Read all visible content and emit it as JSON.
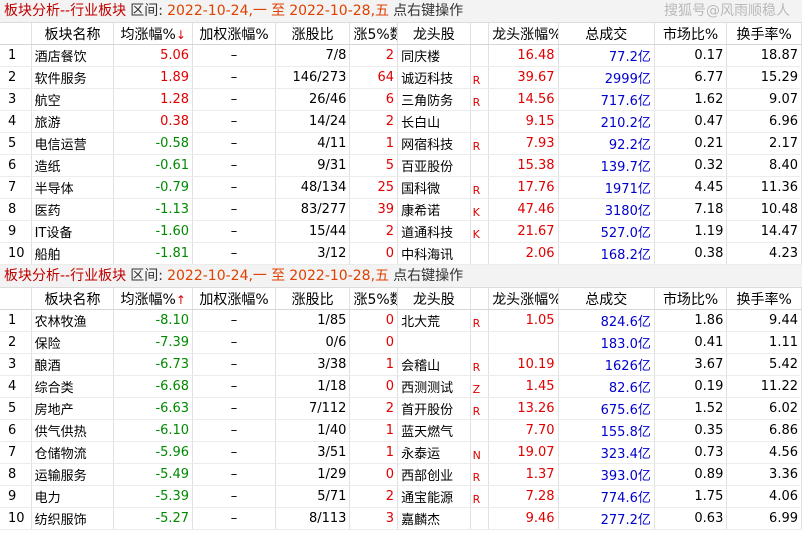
{
  "panels": [
    {
      "title": "板块分析--行业板块",
      "range_label": "区间:",
      "range_start": "2022-10-24,一",
      "range_to": "至",
      "range_end": "2022-10-28,五",
      "hint": "点右键操作",
      "watermark": "搜狐号@风雨顺稳人",
      "sort_arrow": "↓",
      "headers": [
        "",
        "板块名称",
        "均涨幅%",
        "加权涨幅%",
        "涨股比",
        "涨5%数",
        "龙头股",
        "",
        "龙头涨幅%",
        "总成交",
        "市场比%",
        "换手率%"
      ],
      "rows": [
        {
          "idx": "1",
          "name": "酒店餐饮",
          "avg": "5.06",
          "weighted": "–",
          "up_ratio": "7/8",
          "up5": "2",
          "leader": "同庆楼",
          "mark": "",
          "leader_chg": "16.48",
          "turnover": "77.2亿",
          "market": "0.17",
          "turnover_rate": "18.87"
        },
        {
          "idx": "2",
          "name": "软件服务",
          "avg": "1.89",
          "weighted": "–",
          "up_ratio": "146/273",
          "up5": "64",
          "leader": "诚迈科技",
          "mark": "R",
          "leader_chg": "39.67",
          "turnover": "2999亿",
          "market": "6.77",
          "turnover_rate": "15.29"
        },
        {
          "idx": "3",
          "name": "航空",
          "avg": "1.28",
          "weighted": "–",
          "up_ratio": "26/46",
          "up5": "6",
          "leader": "三角防务",
          "mark": "R",
          "leader_chg": "14.56",
          "turnover": "717.6亿",
          "market": "1.62",
          "turnover_rate": "9.07"
        },
        {
          "idx": "4",
          "name": "旅游",
          "avg": "0.38",
          "weighted": "–",
          "up_ratio": "14/24",
          "up5": "2",
          "leader": "长白山",
          "mark": "",
          "leader_chg": "9.15",
          "turnover": "210.2亿",
          "market": "0.47",
          "turnover_rate": "6.96"
        },
        {
          "idx": "5",
          "name": "电信运营",
          "avg": "-0.58",
          "weighted": "–",
          "up_ratio": "4/11",
          "up5": "1",
          "leader": "网宿科技",
          "mark": "R",
          "leader_chg": "7.93",
          "turnover": "92.2亿",
          "market": "0.21",
          "turnover_rate": "2.17"
        },
        {
          "idx": "6",
          "name": "造纸",
          "avg": "-0.61",
          "weighted": "–",
          "up_ratio": "9/31",
          "up5": "5",
          "leader": "百亚股份",
          "mark": "",
          "leader_chg": "15.38",
          "turnover": "139.7亿",
          "market": "0.32",
          "turnover_rate": "8.40"
        },
        {
          "idx": "7",
          "name": "半导体",
          "avg": "-0.79",
          "weighted": "–",
          "up_ratio": "48/134",
          "up5": "25",
          "leader": "国科微",
          "mark": "R",
          "leader_chg": "17.76",
          "turnover": "1971亿",
          "market": "4.45",
          "turnover_rate": "11.36"
        },
        {
          "idx": "8",
          "name": "医药",
          "avg": "-1.13",
          "weighted": "–",
          "up_ratio": "83/277",
          "up5": "39",
          "leader": "康希诺",
          "mark": "K",
          "leader_chg": "47.46",
          "turnover": "3180亿",
          "market": "7.18",
          "turnover_rate": "10.48"
        },
        {
          "idx": "9",
          "name": "IT设备",
          "avg": "-1.60",
          "weighted": "–",
          "up_ratio": "15/44",
          "up5": "2",
          "leader": "道通科技",
          "mark": "K",
          "leader_chg": "21.67",
          "turnover": "527.0亿",
          "market": "1.19",
          "turnover_rate": "14.47"
        },
        {
          "idx": "10",
          "name": "船舶",
          "avg": "-1.81",
          "weighted": "–",
          "up_ratio": "3/12",
          "up5": "0",
          "leader": "中科海讯",
          "mark": "",
          "leader_chg": "2.06",
          "turnover": "168.2亿",
          "market": "0.38",
          "turnover_rate": "4.23"
        }
      ]
    },
    {
      "title": "板块分析--行业板块",
      "range_label": "区间:",
      "range_start": "2022-10-24,一",
      "range_to": "至",
      "range_end": "2022-10-28,五",
      "hint": "点右键操作",
      "watermark": "",
      "sort_arrow": "↑",
      "headers": [
        "",
        "板块名称",
        "均涨幅%",
        "加权涨幅%",
        "涨股比",
        "涨5%数",
        "龙头股",
        "",
        "龙头涨幅%",
        "总成交",
        "市场比%",
        "换手率%"
      ],
      "rows": [
        {
          "idx": "1",
          "name": "农林牧渔",
          "avg": "-8.10",
          "weighted": "–",
          "up_ratio": "1/85",
          "up5": "0",
          "leader": "北大荒",
          "mark": "R",
          "leader_chg": "1.05",
          "turnover": "824.6亿",
          "market": "1.86",
          "turnover_rate": "9.44"
        },
        {
          "idx": "2",
          "name": "保险",
          "avg": "-7.39",
          "weighted": "–",
          "up_ratio": "0/6",
          "up5": "0",
          "leader": "",
          "mark": "",
          "leader_chg": "",
          "turnover": "183.0亿",
          "market": "0.41",
          "turnover_rate": "1.11"
        },
        {
          "idx": "3",
          "name": "酿酒",
          "avg": "-6.73",
          "weighted": "–",
          "up_ratio": "3/38",
          "up5": "1",
          "leader": "会稽山",
          "mark": "R",
          "leader_chg": "10.19",
          "turnover": "1626亿",
          "market": "3.67",
          "turnover_rate": "5.42"
        },
        {
          "idx": "4",
          "name": "综合类",
          "avg": "-6.68",
          "weighted": "–",
          "up_ratio": "1/18",
          "up5": "0",
          "leader": "西测测试",
          "mark": "Z",
          "leader_chg": "1.45",
          "turnover": "82.6亿",
          "market": "0.19",
          "turnover_rate": "11.22"
        },
        {
          "idx": "5",
          "name": "房地产",
          "avg": "-6.63",
          "weighted": "–",
          "up_ratio": "7/112",
          "up5": "2",
          "leader": "首开股份",
          "mark": "R",
          "leader_chg": "13.26",
          "turnover": "675.6亿",
          "market": "1.52",
          "turnover_rate": "6.02"
        },
        {
          "idx": "6",
          "name": "供气供热",
          "avg": "-6.10",
          "weighted": "–",
          "up_ratio": "1/40",
          "up5": "1",
          "leader": "蓝天燃气",
          "mark": "",
          "leader_chg": "7.70",
          "turnover": "155.8亿",
          "market": "0.35",
          "turnover_rate": "6.86"
        },
        {
          "idx": "7",
          "name": "仓储物流",
          "avg": "-5.96",
          "weighted": "–",
          "up_ratio": "3/51",
          "up5": "1",
          "leader": "永泰运",
          "mark": "N",
          "leader_chg": "19.07",
          "turnover": "323.4亿",
          "market": "0.73",
          "turnover_rate": "4.56"
        },
        {
          "idx": "8",
          "name": "运输服务",
          "avg": "-5.49",
          "weighted": "–",
          "up_ratio": "1/29",
          "up5": "0",
          "leader": "西部创业",
          "mark": "R",
          "leader_chg": "1.37",
          "turnover": "393.0亿",
          "market": "0.89",
          "turnover_rate": "3.36"
        },
        {
          "idx": "9",
          "name": "电力",
          "avg": "-5.39",
          "weighted": "–",
          "up_ratio": "5/71",
          "up5": "2",
          "leader": "通宝能源",
          "mark": "R",
          "leader_chg": "7.28",
          "turnover": "774.6亿",
          "market": "1.75",
          "turnover_rate": "4.06"
        },
        {
          "idx": "10",
          "name": "纺织服饰",
          "avg": "-5.27",
          "weighted": "–",
          "up_ratio": "8/113",
          "up5": "3",
          "leader": "嘉麟杰",
          "mark": "",
          "leader_chg": "9.46",
          "turnover": "277.2亿",
          "market": "0.63",
          "turnover_rate": "6.99"
        }
      ]
    }
  ],
  "colors": {
    "up": "#e00000",
    "down": "#008a00",
    "turnover": "#0000cc",
    "title": "#c00000",
    "range": "#e04000"
  }
}
